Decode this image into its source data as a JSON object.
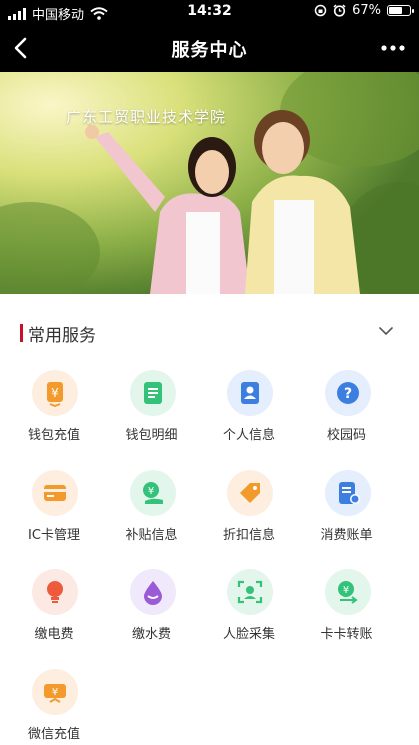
{
  "status_bar": {
    "carrier": "中国移动",
    "time": "14:32",
    "battery": "67%",
    "battery_level": 0.67,
    "icons": [
      "signal-icon",
      "wifi-icon",
      "orientation-lock-icon",
      "alarm-icon",
      "battery-icon"
    ]
  },
  "nav": {
    "title": "服务中心",
    "back_icon": "back-arrow-icon",
    "more_icon": "more-icon"
  },
  "banner": {
    "text": "广东工贸职业技术学院"
  },
  "section": {
    "title": "常用服务",
    "accent": "#c8102e",
    "toggle_icon": "chevron-down-icon"
  },
  "services": [
    {
      "label": "钱包充值",
      "icon": "wallet-topup-icon",
      "bg": "#fdeee0",
      "fg": "#f39a2c"
    },
    {
      "label": "钱包明细",
      "icon": "wallet-detail-icon",
      "bg": "#e3f6ec",
      "fg": "#34c27a"
    },
    {
      "label": "个人信息",
      "icon": "contact-card-icon",
      "bg": "#e4eefc",
      "fg": "#3d7fe0"
    },
    {
      "label": "校园码",
      "icon": "question-icon",
      "bg": "#e4eefc",
      "fg": "#3d7fe0"
    },
    {
      "label": "IC卡管理",
      "icon": "card-icon",
      "bg": "#fdeee0",
      "fg": "#f39a2c"
    },
    {
      "label": "补贴信息",
      "icon": "subsidy-icon",
      "bg": "#e3f6ec",
      "fg": "#34c27a"
    },
    {
      "label": "折扣信息",
      "icon": "tag-icon",
      "bg": "#fdeee0",
      "fg": "#f39a2c"
    },
    {
      "label": "消费账单",
      "icon": "bill-icon",
      "bg": "#e4eefc",
      "fg": "#3d7fe0"
    },
    {
      "label": "缴电费",
      "icon": "lightbulb-icon",
      "bg": "#fde9e4",
      "fg": "#ee5a3c"
    },
    {
      "label": "缴水费",
      "icon": "water-drop-icon",
      "bg": "#f0e8fb",
      "fg": "#9b5ad6"
    },
    {
      "label": "人脸采集",
      "icon": "face-scan-icon",
      "bg": "#e3f6ec",
      "fg": "#34c27a"
    },
    {
      "label": "卡卡转账",
      "icon": "transfer-icon",
      "bg": "#e3f6ec",
      "fg": "#34c27a"
    },
    {
      "label": "微信充值",
      "icon": "wechat-topup-icon",
      "bg": "#fdeee0",
      "fg": "#f39a2c"
    }
  ]
}
